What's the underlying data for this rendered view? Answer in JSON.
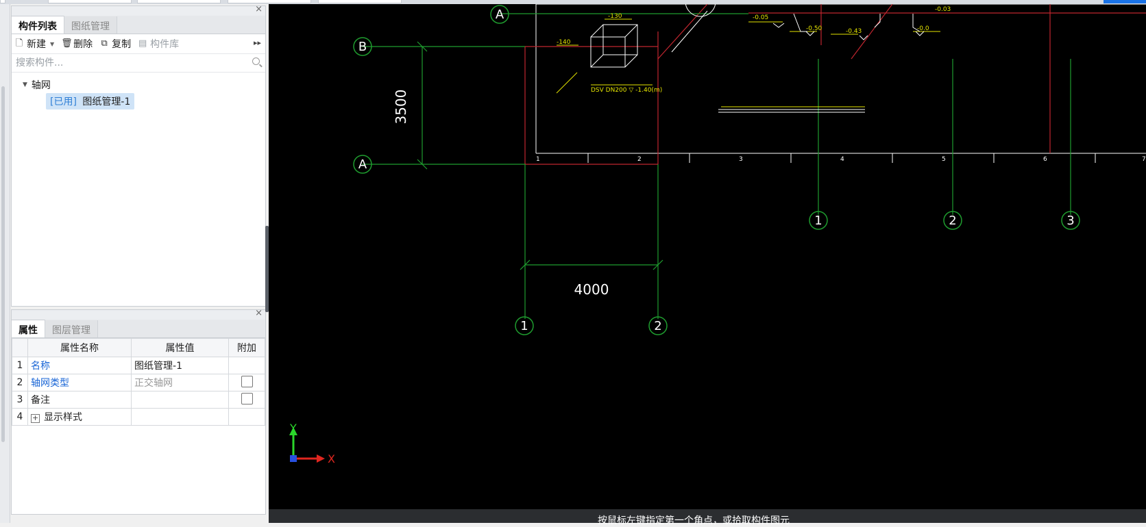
{
  "component_panel": {
    "tabs": [
      "构件列表",
      "图纸管理"
    ],
    "toolbar": {
      "new_label": "新建",
      "delete_label": "删除",
      "copy_label": "复制",
      "library_label": "构件库"
    },
    "search_placeholder": "搜索构件...",
    "tree": {
      "root_label": "轴网",
      "item_tag": "[已用]",
      "item_label": "图纸管理-1"
    }
  },
  "property_panel": {
    "tabs": [
      "属性",
      "图层管理"
    ],
    "columns": [
      "属性名称",
      "属性值",
      "附加"
    ],
    "rows": [
      {
        "num": "1",
        "name": "名称",
        "value": "图纸管理-1"
      },
      {
        "num": "2",
        "name": "轴网类型",
        "value": "正交轴网"
      },
      {
        "num": "3",
        "name": "备注",
        "value": ""
      },
      {
        "num": "4",
        "name": "显示样式",
        "value": ""
      }
    ]
  },
  "canvas": {
    "grid_labels": {
      "row_a": "A",
      "row_b": "B",
      "row_a_top": "A",
      "col_1": "1",
      "col_2": "2",
      "col_3": "3",
      "col_1_bottom": "1",
      "col_2_bottom": "2"
    },
    "dimensions": {
      "vertical": "3500",
      "horizontal": "4000"
    },
    "ruler_labels": [
      "1",
      "2",
      "3",
      "4",
      "5",
      "6",
      "7"
    ],
    "annotations": {
      "level_1": "-140",
      "level_2": "-130",
      "level_3": "-0.05",
      "level_4": "-0.50",
      "level_5": "-0.43",
      "level_6": "-0.0",
      "level_7": "-0.03",
      "pipe_label": "DSV  DN200  ▽ -1.40(m)"
    },
    "axis": {
      "x": "X",
      "y": "Y"
    },
    "colors": {
      "background": "#000000",
      "grid_line": "#1f9d2f",
      "red_line": "#c0262f",
      "yellow": "#e6e600",
      "white": "#ffffff"
    }
  },
  "status_bar": {
    "message": "按鼠标左键指定第一个角点，或拾取构件图元"
  }
}
